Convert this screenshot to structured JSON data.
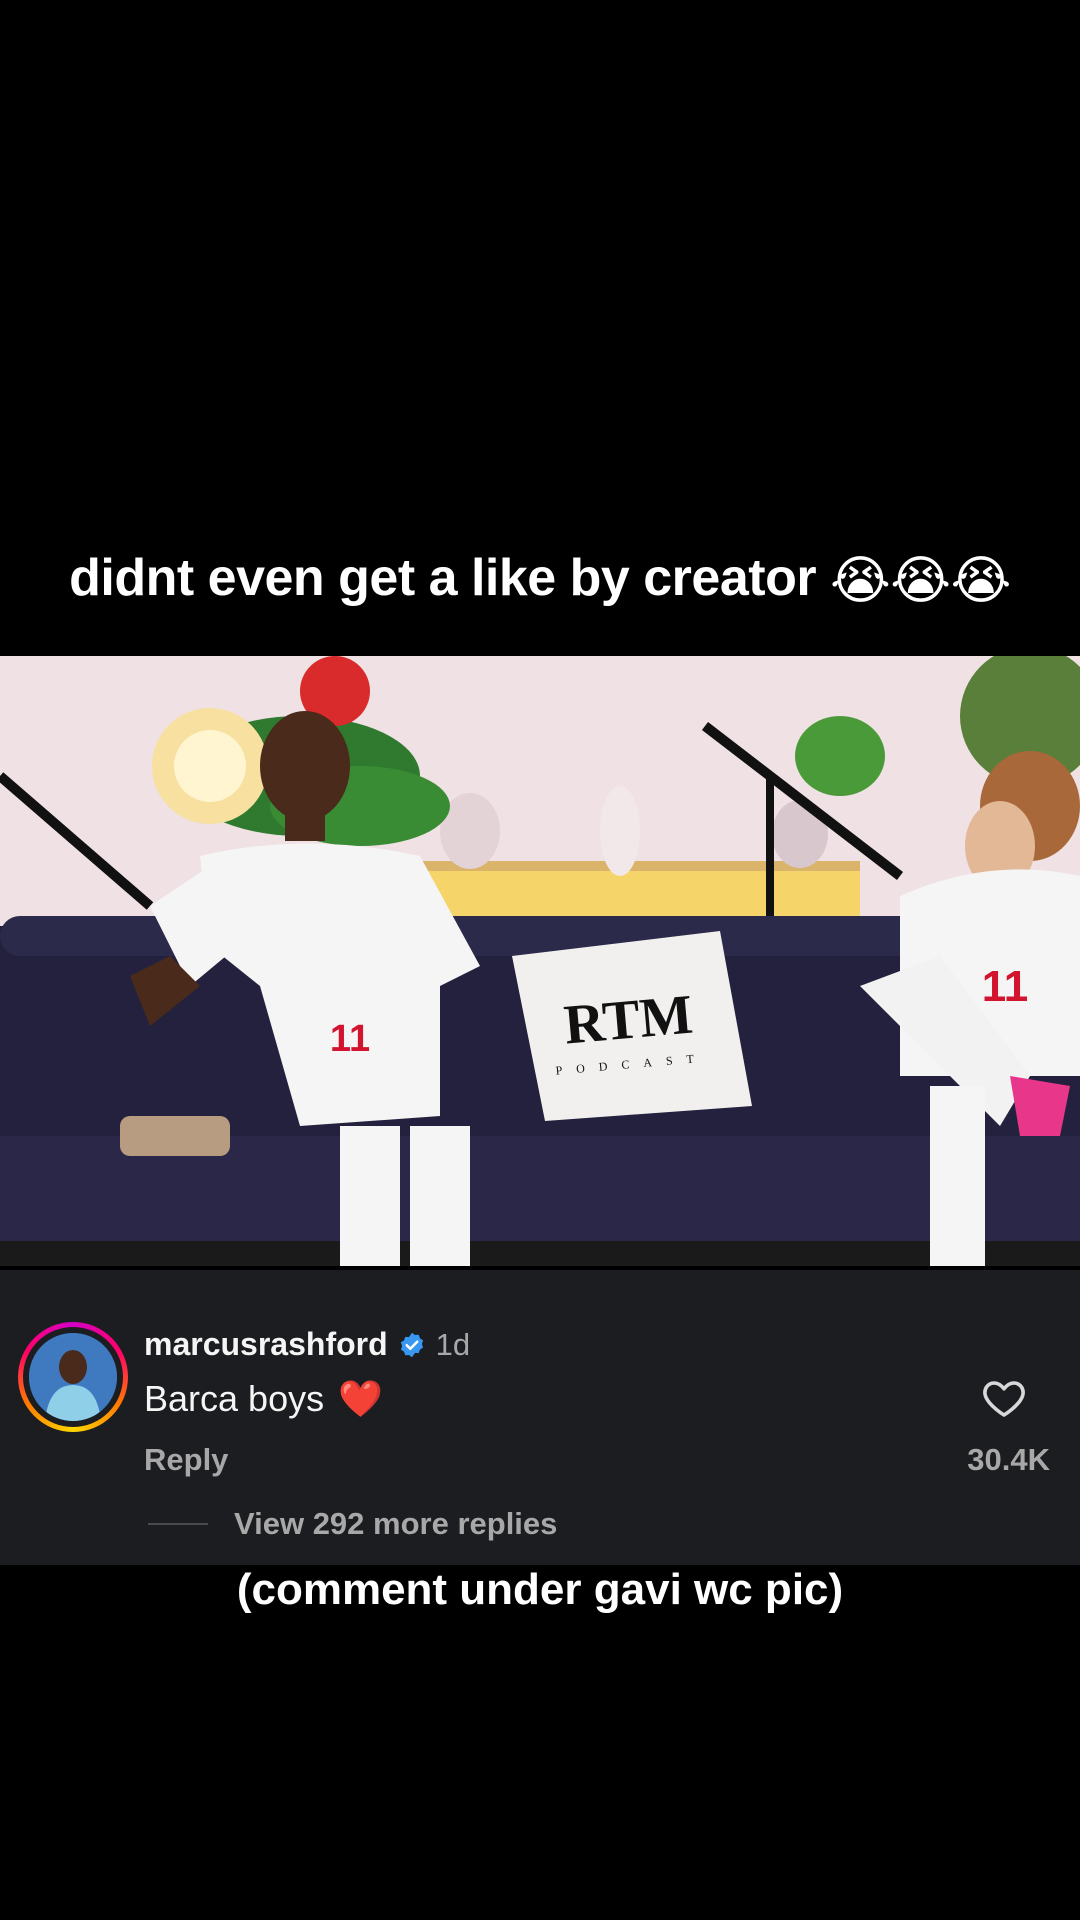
{
  "top_caption": "didnt even get a like by creator",
  "top_caption_emojis": [
    "😭",
    "😭",
    "😭"
  ],
  "photo": {
    "pillow_text": "RTM",
    "pillow_subtext": "PODCAST",
    "player_left_number": "11",
    "player_right_number": "11"
  },
  "comment": {
    "username": "marcusrashford",
    "verified_icon": "verified-badge-icon",
    "time": "1d",
    "text": "Barca boys",
    "text_emoji": "❤️",
    "reply_label": "Reply",
    "like_icon": "heart-outline-icon",
    "like_count": "30.4K",
    "view_replies": "View 292 more replies"
  },
  "bottom_caption": "(comment under gavi wc pic)",
  "colors": {
    "panel_bg": "#1c1d20",
    "verified_blue": "#3897f0",
    "muted_text": "#a8a8a8"
  }
}
